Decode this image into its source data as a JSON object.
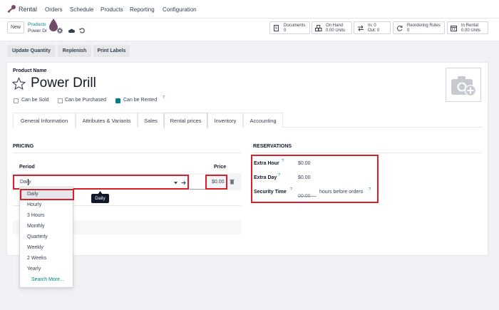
{
  "app": {
    "name": "Rental",
    "menu": [
      "Orders",
      "Schedule",
      "Products",
      "Reporting",
      "Configuration"
    ]
  },
  "control": {
    "new_label": "New",
    "breadcrumb_parent": "Products",
    "breadcrumb_current": "Power Dr"
  },
  "stats": [
    {
      "label": "Documents",
      "value": "0"
    },
    {
      "label": "On Hand",
      "value": "0.00 Units"
    },
    {
      "label": "In: 0",
      "value": "Out: 0"
    },
    {
      "label": "Reordering Rules",
      "value": "0"
    },
    {
      "label": "In Rental",
      "value": "0.00 Units"
    }
  ],
  "actions": [
    "Update Quantity",
    "Replenish",
    "Print Labels"
  ],
  "product": {
    "name_label": "Product Name",
    "name": "Power Drill",
    "can_be_sold": "Can be Sold",
    "can_be_purchased": "Can be Purchased",
    "can_be_rented": "Can be Rented",
    "rented_help": "?"
  },
  "tabs": [
    "General Information",
    "Attributes & Variants",
    "Sales",
    "Rental prices",
    "Inventory",
    "Accounting"
  ],
  "pricing": {
    "title": "PRICING",
    "col_period": "Period",
    "col_price": "Price",
    "period_value": "Daily",
    "price_value": "$0.00"
  },
  "dropdown": {
    "options": [
      "Daily",
      "Hourly",
      "3 Hours",
      "Monthly",
      "Quarterly",
      "Weekly",
      "2 Weeks",
      "Yearly"
    ],
    "search_more": "Search More...",
    "tooltip": "Daily"
  },
  "reservations": {
    "title": "RESERVATIONS",
    "extra_hour_label": "Extra Hour",
    "extra_hour_value": "$0.00",
    "extra_day_label": "Extra Day",
    "extra_day_value": "$0.00",
    "security_label": "Security Time",
    "security_value": "00:00",
    "security_suffix": "hours before orders",
    "help": "?"
  },
  "colors": {
    "accent": "#714b67",
    "highlight": "#d6212b",
    "link": "#017e84"
  }
}
